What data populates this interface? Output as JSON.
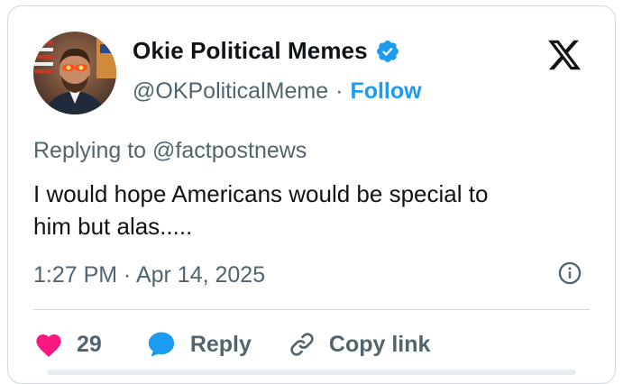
{
  "author": {
    "name": "Okie Political Memes",
    "handle": "@OKPoliticalMeme",
    "separator": "·",
    "follow_label": "Follow"
  },
  "reply_context": "Replying to @factpostnews",
  "tweet": {
    "text_line1": "I would hope Americans would be special to",
    "text_line2": "him but alas....."
  },
  "timestamp": "1:27 PM · Apr 14, 2025",
  "actions": {
    "like_count": "29",
    "reply_label": "Reply",
    "copy_link_label": "Copy link"
  },
  "colors": {
    "accent": "#1d9bf0",
    "like": "#f91880",
    "secondary_text": "#536471"
  },
  "icons": [
    "verified-badge-icon",
    "x-logo-icon",
    "info-icon",
    "heart-icon",
    "reply-bubble-icon",
    "link-icon"
  ]
}
